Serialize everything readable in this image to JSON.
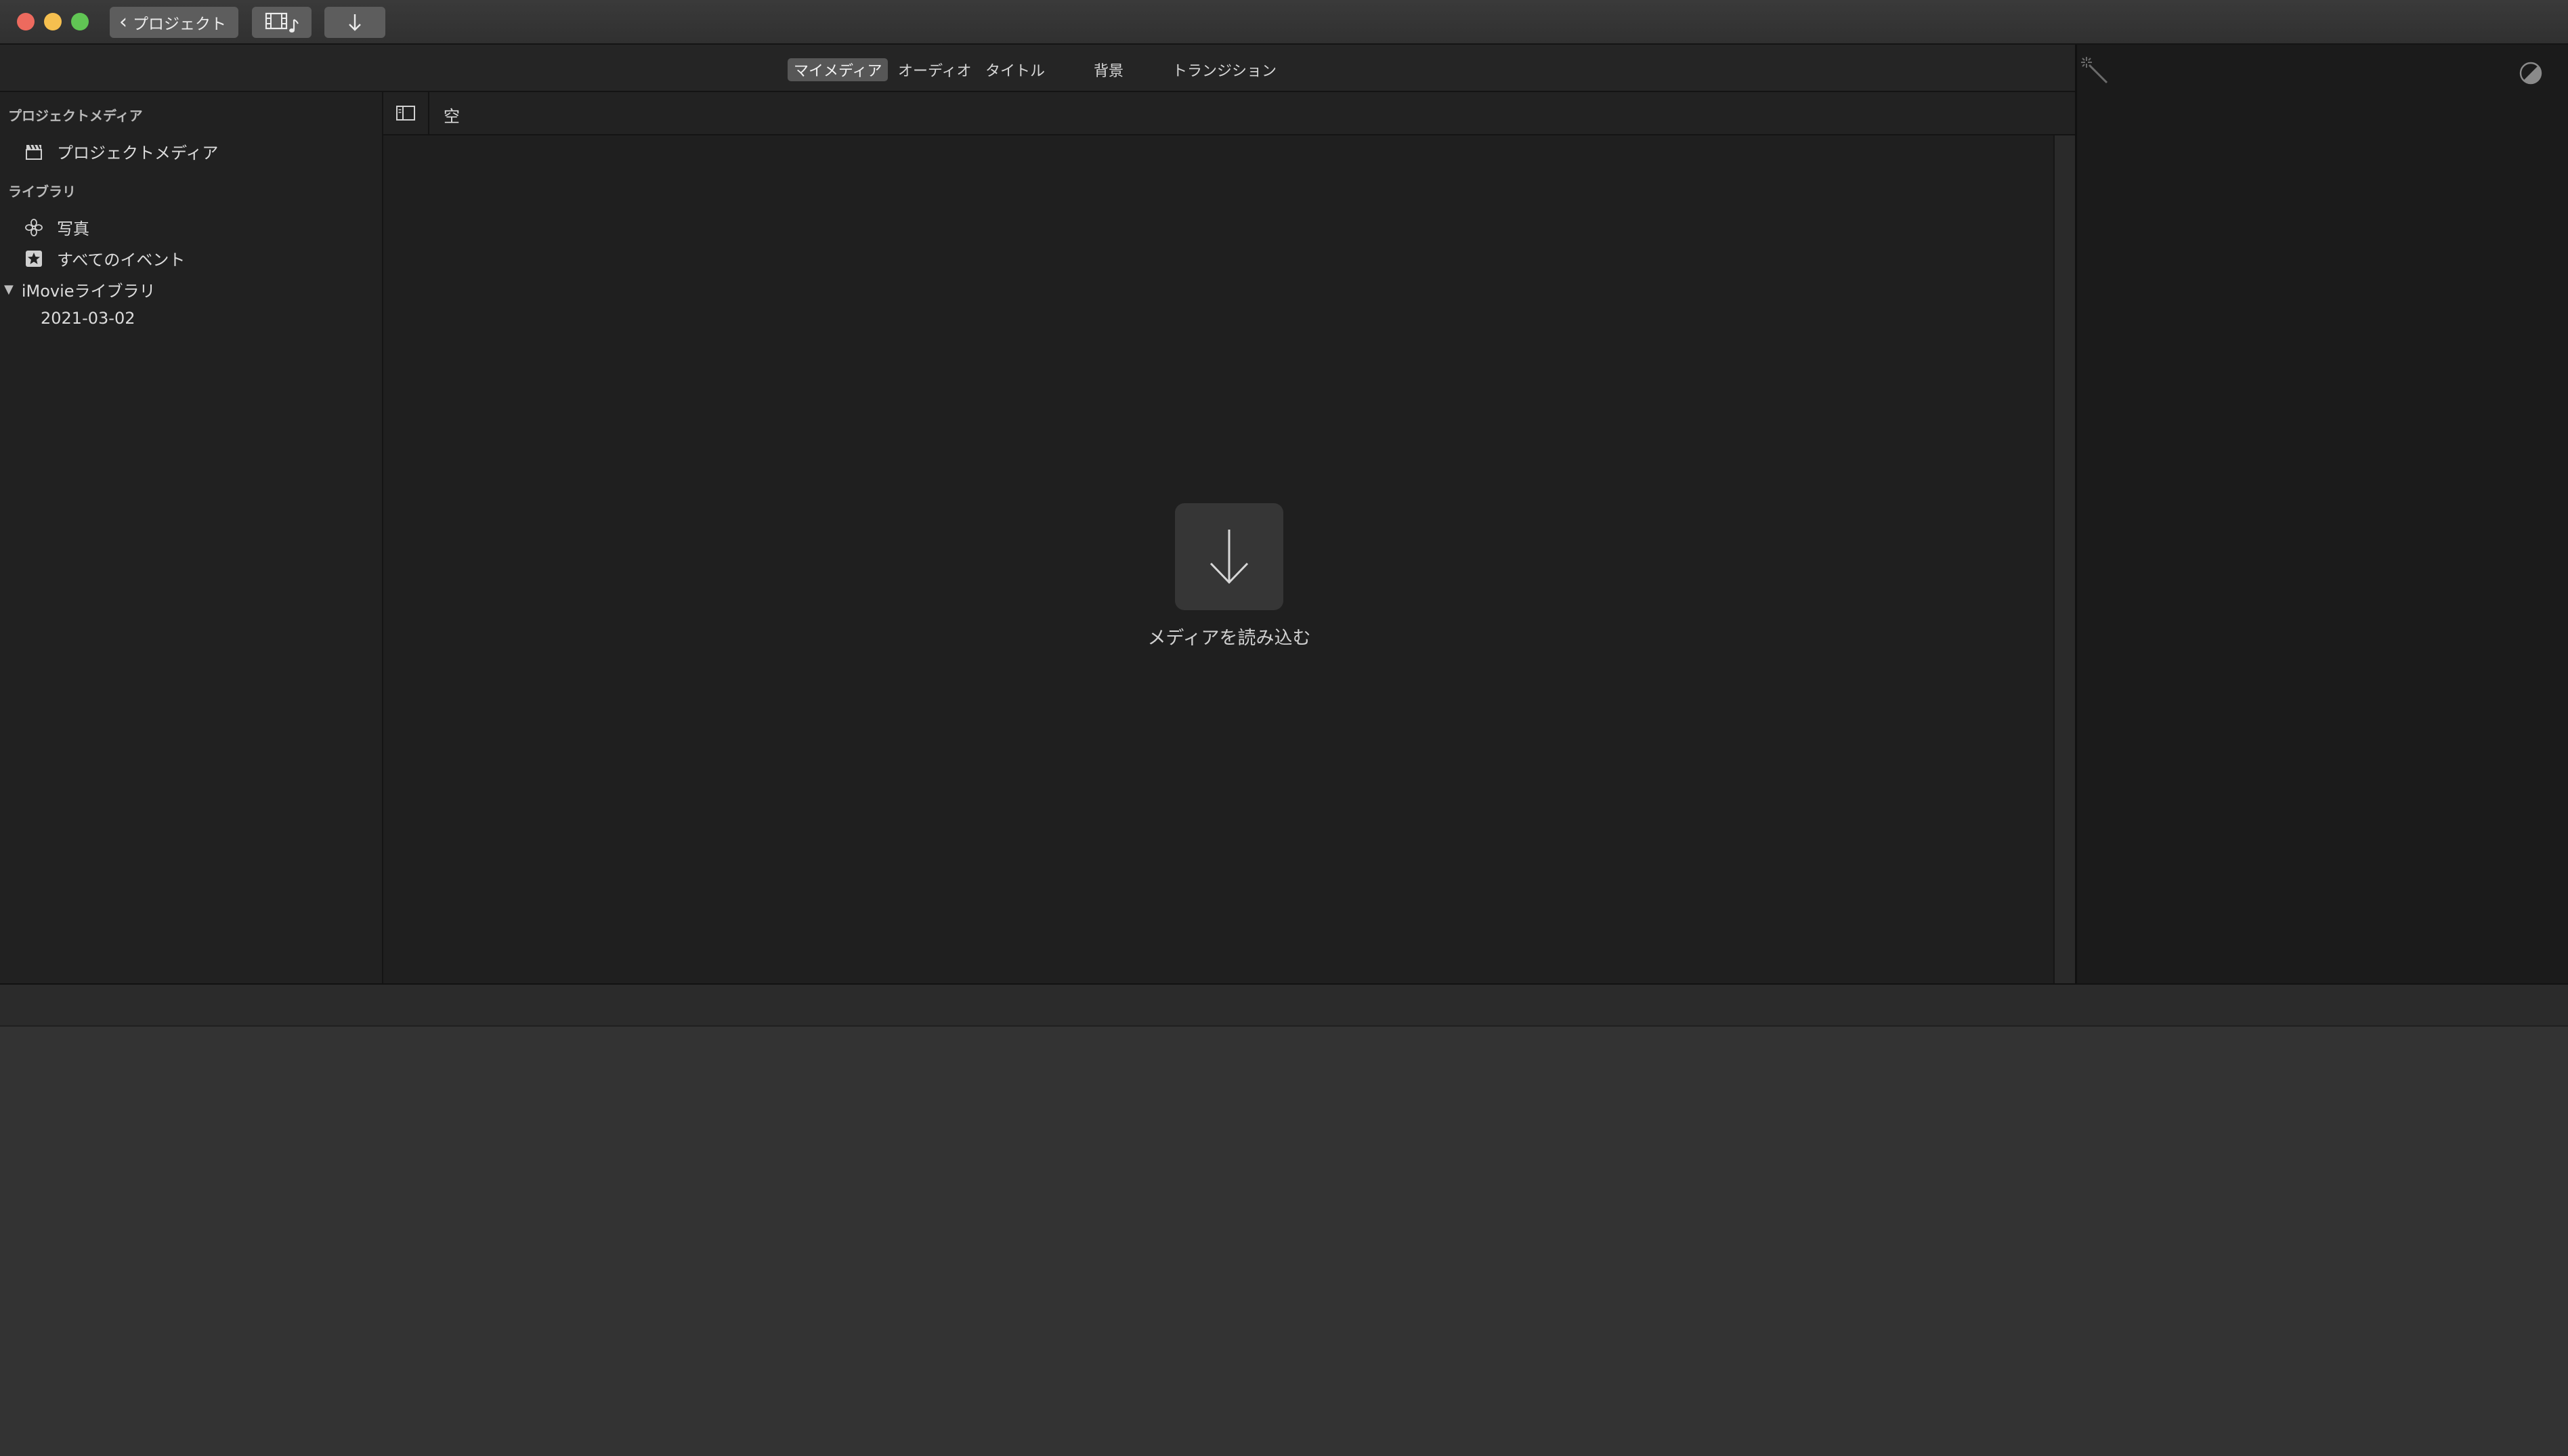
{
  "toolbar": {
    "back_label": "プロジェクト",
    "back_icon": "chevron-left-icon",
    "media_toggle_icon": "film-music-icon",
    "import_icon": "arrow-down-icon"
  },
  "browser_tabs": [
    "マイメディア",
    "オーディオ",
    "タイトル",
    "背景",
    "トランジション"
  ],
  "sidebar": {
    "project_media_header": "プロジェクトメディア",
    "project_media_item": "プロジェクトメディア",
    "library_header": "ライブラリ",
    "photos_item": "写真",
    "all_events_item": "すべてのイベント",
    "library_name": "iMovieライブラリ",
    "event_name": "2021-03-02"
  },
  "content": {
    "filter_label": "空",
    "import_media_label": "メディアを読み込む"
  },
  "colors": {
    "close": "#ed6a5e",
    "minimize": "#f5bf4f",
    "maximize": "#61c554",
    "selected_tab": "#575757",
    "timeline_bg": "#333333"
  }
}
